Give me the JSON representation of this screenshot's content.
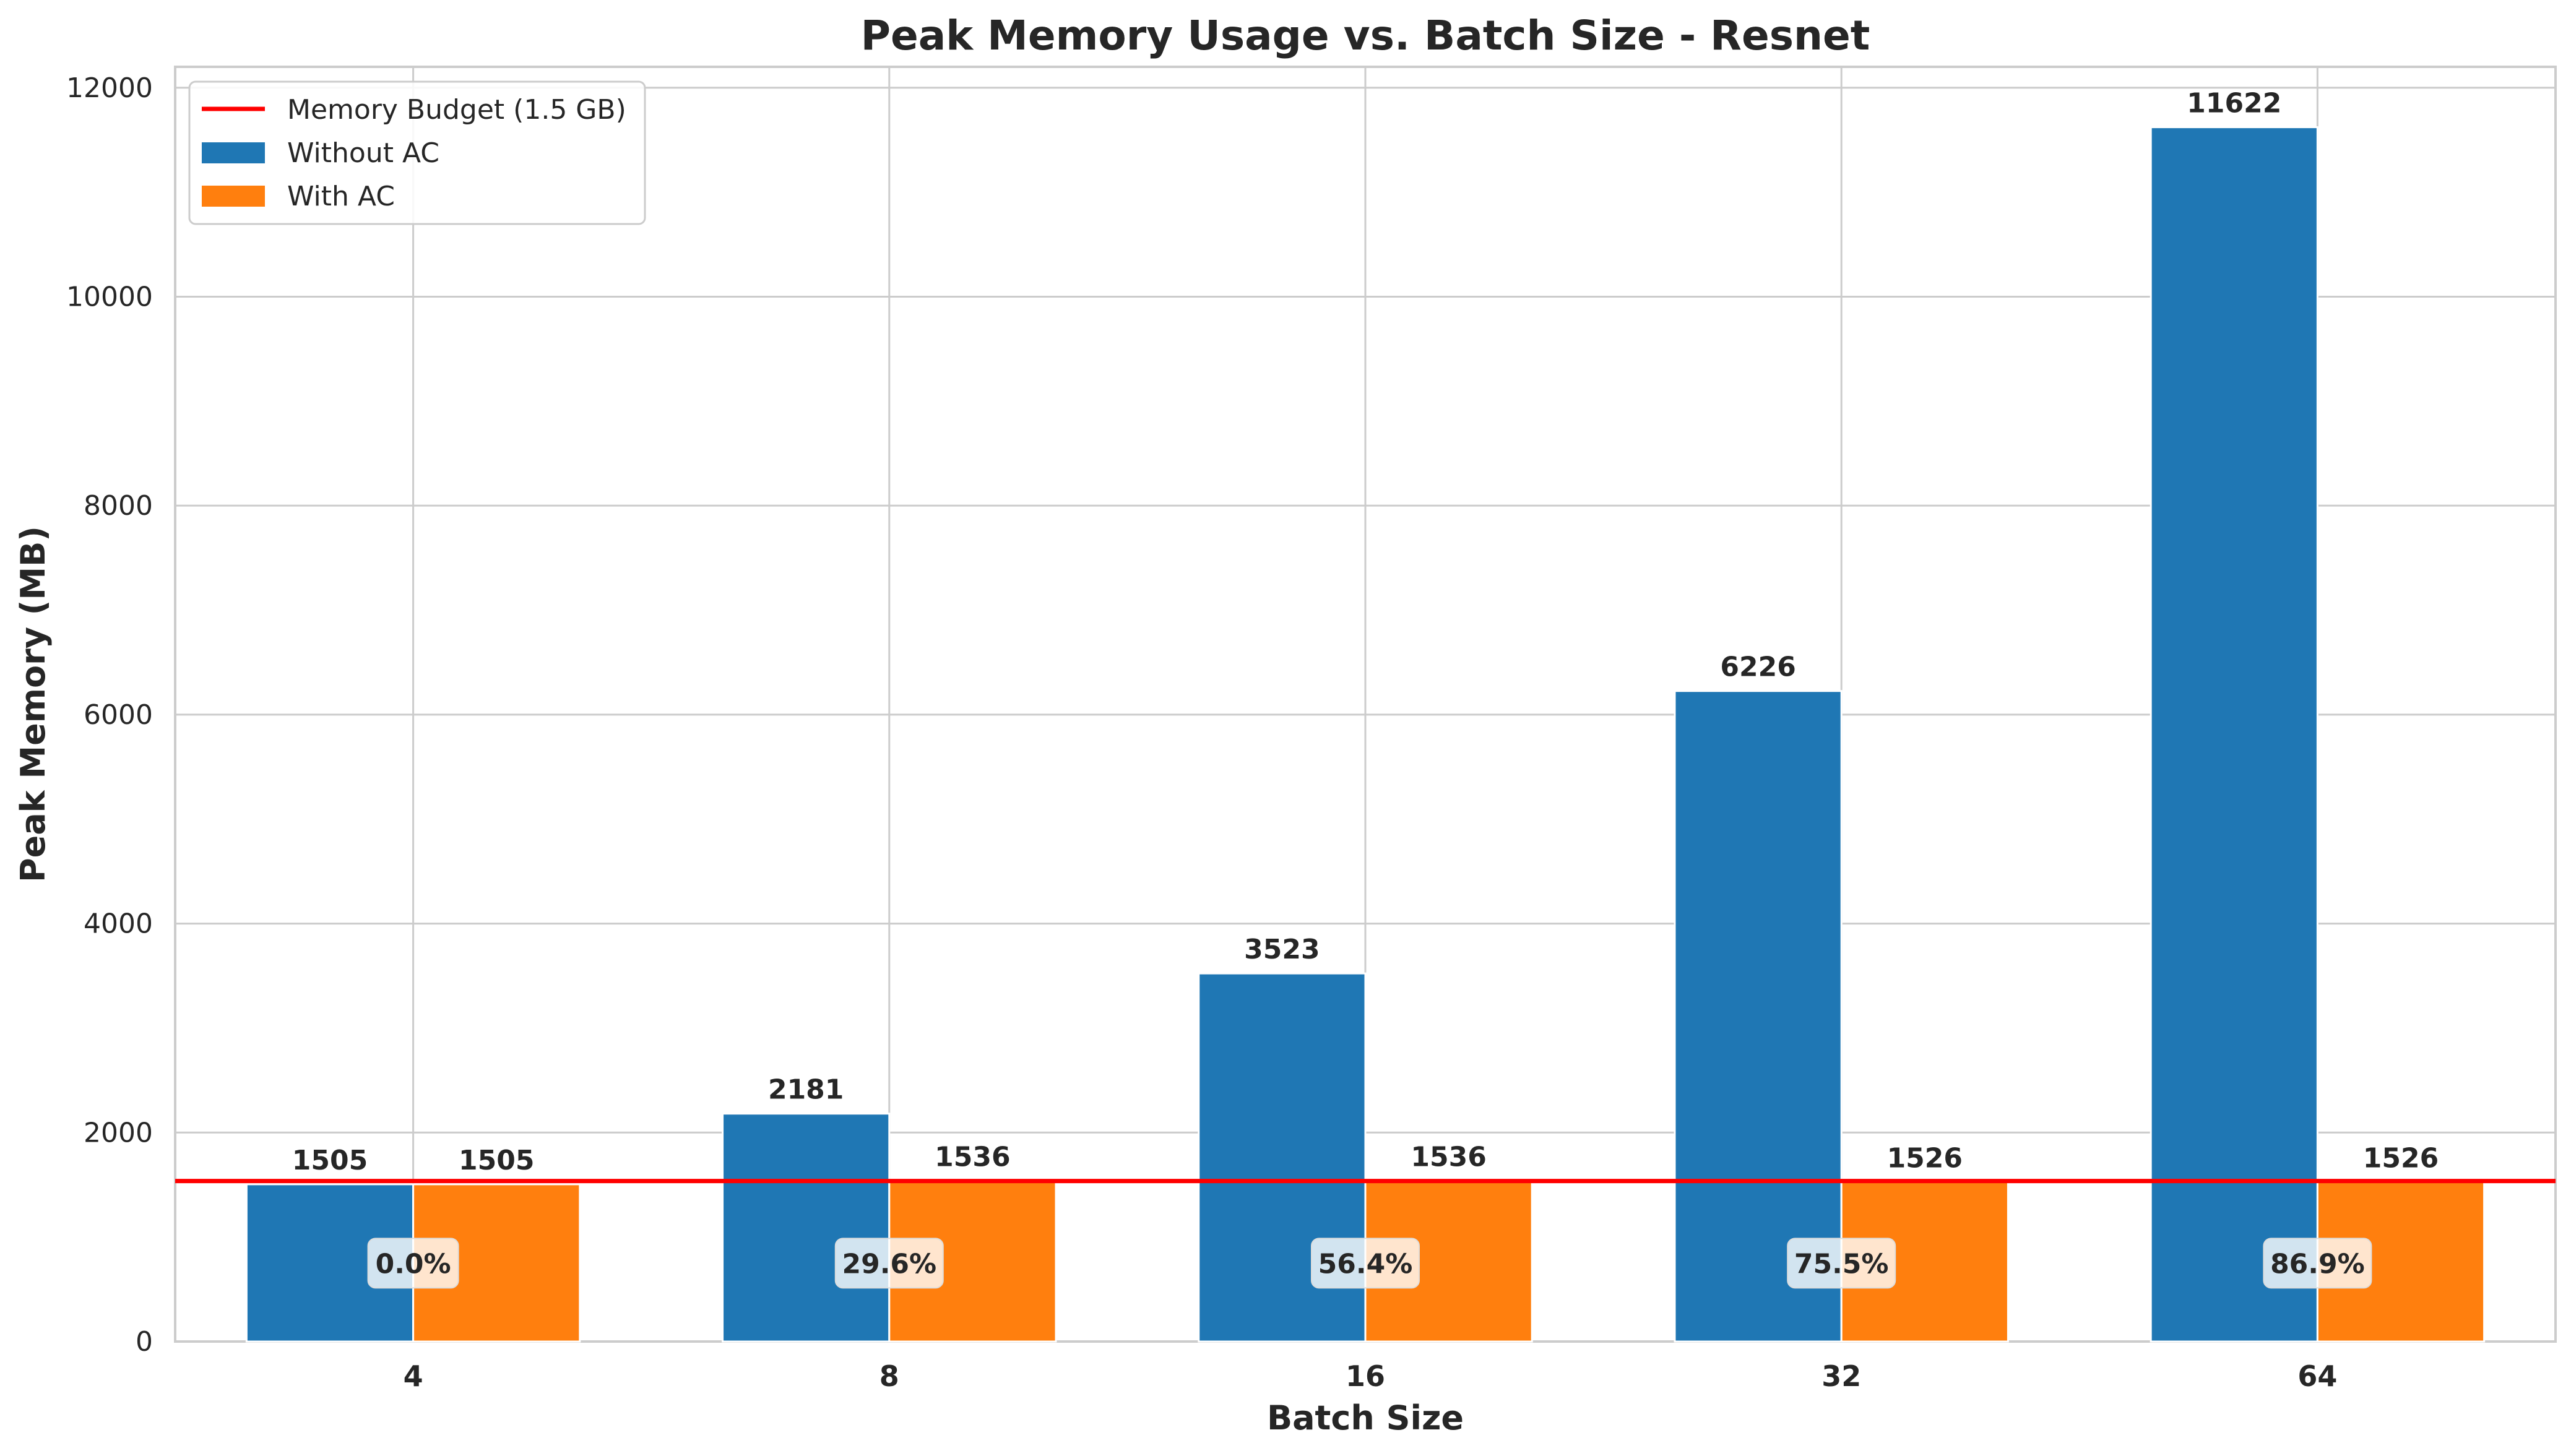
{
  "chart_data": {
    "type": "bar",
    "title": "Peak Memory Usage vs. Batch Size - Resnet",
    "xlabel": "Batch Size",
    "ylabel": "Peak Memory (MB)",
    "categories": [
      "4",
      "8",
      "16",
      "32",
      "64"
    ],
    "series": [
      {
        "name": "Without AC",
        "color": "#1f77b4",
        "values": [
          1505,
          2181,
          3523,
          6226,
          11622
        ]
      },
      {
        "name": "With AC",
        "color": "#ff7f0e",
        "values": [
          1505,
          1536,
          1536,
          1526,
          1526
        ]
      }
    ],
    "reference_line": {
      "name": "Memory Budget (1.5 GB)",
      "value": 1536,
      "color": "#ff0000"
    },
    "reductions": [
      "0.0%",
      "29.6%",
      "56.4%",
      "75.5%",
      "86.9%"
    ],
    "ylim": [
      0,
      12200
    ],
    "yticks": [
      0,
      2000,
      4000,
      6000,
      8000,
      10000,
      12000
    ],
    "grid": true,
    "legend_position": "top-left"
  }
}
